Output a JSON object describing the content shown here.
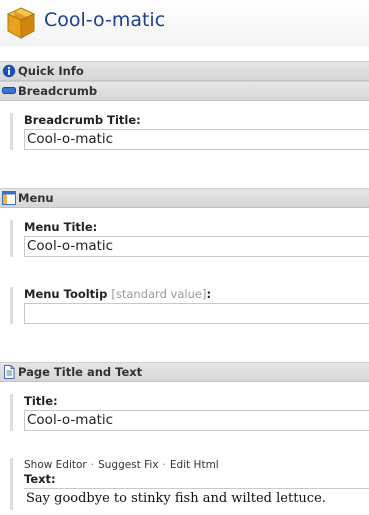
{
  "header": {
    "title": "Cool-o-matic",
    "icon": "cube-box-icon"
  },
  "sections": {
    "quick_info": {
      "label": "Quick Info",
      "icon": "info-circle-icon"
    },
    "breadcrumb": {
      "label": "Breadcrumb",
      "icon": "breadcrumb-bar-icon"
    },
    "menu": {
      "label": "Menu",
      "icon": "menu-window-icon"
    },
    "page_title_text": {
      "label": "Page Title and Text",
      "icon": "document-icon"
    }
  },
  "fields": {
    "breadcrumb_title": {
      "label": "Breadcrumb Title:",
      "value": "Cool-o-matic"
    },
    "menu_title": {
      "label": "Menu Title:",
      "value": "Cool-o-matic"
    },
    "menu_tooltip": {
      "label": "Menu Tooltip",
      "hint": "[standard value]",
      "suffix": ":",
      "value": ""
    },
    "title": {
      "label": "Title:",
      "value": "Cool-o-matic"
    },
    "text": {
      "label": "Text:",
      "value": "Say goodbye to stinky fish and wilted lettuce."
    }
  },
  "text_toolbar": {
    "show_editor": "Show Editor",
    "suggest_fix": "Suggest Fix",
    "edit_html": "Edit Html",
    "separator": "·"
  },
  "colors": {
    "title": "#1a3f8b",
    "bar": "#dadada",
    "info": "#1e4fb3"
  }
}
